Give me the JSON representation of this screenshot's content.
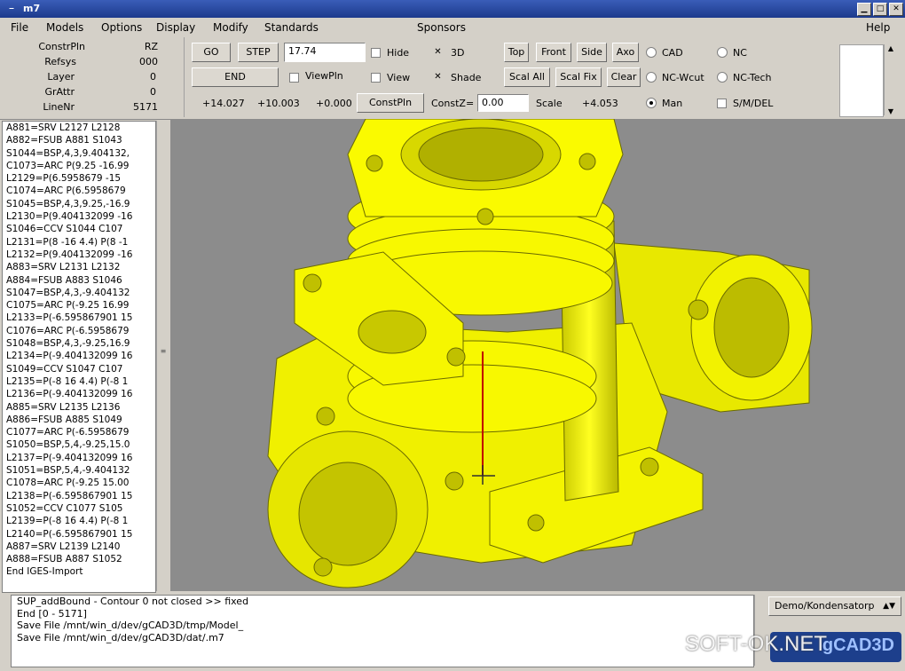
{
  "window": {
    "title": "m7"
  },
  "menubar": {
    "items": [
      "File",
      "Models",
      "Options",
      "Display",
      "Modify",
      "Standards",
      "Sponsors"
    ],
    "help": "Help"
  },
  "info": [
    {
      "label": "ConstrPln",
      "value": "RZ"
    },
    {
      "label": "Refsys",
      "value": "000"
    },
    {
      "label": "Layer",
      "value": "0"
    },
    {
      "label": "GrAttr",
      "value": "0"
    },
    {
      "label": "LineNr",
      "value": "5171"
    }
  ],
  "toolbar": {
    "go": "GO",
    "step": "STEP",
    "end": "END",
    "step_value": "17.74",
    "viewpln": "ViewPln",
    "hide": "Hide",
    "threed": "3D",
    "view": "View",
    "shade": "Shade",
    "top": "Top",
    "front": "Front",
    "side": "Side",
    "axo": "Axo",
    "scal_all": "Scal All",
    "scal_fix": "Scal Fix",
    "clear": "Clear",
    "cad": "CAD",
    "nc": "NC",
    "nc_wcut": "NC-Wcut",
    "nc_tech": "NC-Tech",
    "man": "Man",
    "smdel": "S/M/DEL",
    "coord_x": "+14.027",
    "coord_y": "+10.003",
    "coord_z": "+0.000",
    "constpln": "ConstPln",
    "constz_label": "ConstZ=",
    "constz_value": "0.00",
    "scale_label": "Scale",
    "scale_value": "+4.053"
  },
  "list_items": [
    "A881=SRV L2127 L2128",
    "A882=FSUB A881 S1043",
    "S1044=BSP,4,3,9.404132,",
    "C1073=ARC P(9.25 -16.99",
    "L2129=P(6.5958679 -15",
    "C1074=ARC P(6.5958679",
    "S1045=BSP,4,3,9.25,-16.9",
    "L2130=P(9.404132099 -16",
    "S1046=CCV  S1044 C107",
    "L2131=P(8 -16 4.4) P(8 -1",
    "L2132=P(9.404132099 -16",
    "A883=SRV L2131 L2132",
    "A884=FSUB A883 S1046",
    "S1047=BSP,4,3,-9.404132",
    "C1075=ARC P(-9.25 16.99",
    "L2133=P(-6.595867901 15",
    "C1076=ARC P(-6.5958679",
    "S1048=BSP,4,3,-9.25,16.9",
    "L2134=P(-9.404132099 16",
    "S1049=CCV  S1047 C107",
    "L2135=P(-8 16 4.4) P(-8 1",
    "L2136=P(-9.404132099 16",
    "A885=SRV L2135 L2136",
    "A886=FSUB A885 S1049",
    "C1077=ARC P(-6.5958679",
    "S1050=BSP,5,4,-9.25,15.0",
    "L2137=P(-9.404132099 16",
    "S1051=BSP,5,4,-9.404132",
    "C1078=ARC P(-9.25 15.00",
    "L2138=P(-6.595867901 15",
    "S1052=CCV  C1077 S105",
    "L2139=P(-8 16 4.4) P(-8 1",
    "L2140=P(-6.595867901 15",
    "A887=SRV L2139 L2140",
    "A888=FSUB A887 S1052",
    "End IGES-Import"
  ],
  "messages": [
    "SUP_addBound - Contour 0 not closed  >> fixed",
    "End [0 - 5171]",
    "Save File /mnt/win_d/dev/gCAD3D/tmp/Model_",
    "Save File /mnt/win_d/dev/gCAD3D/dat/.m7"
  ],
  "dropdown": {
    "value": "Demo/Kondensatorp"
  },
  "watermark": {
    "text": "SOFT-OK.NET",
    "logo_text": "gCAD3D"
  },
  "colors": {
    "model": "#ffff00",
    "viewport_bg": "#8c8c8c",
    "axis": "#c00000"
  }
}
